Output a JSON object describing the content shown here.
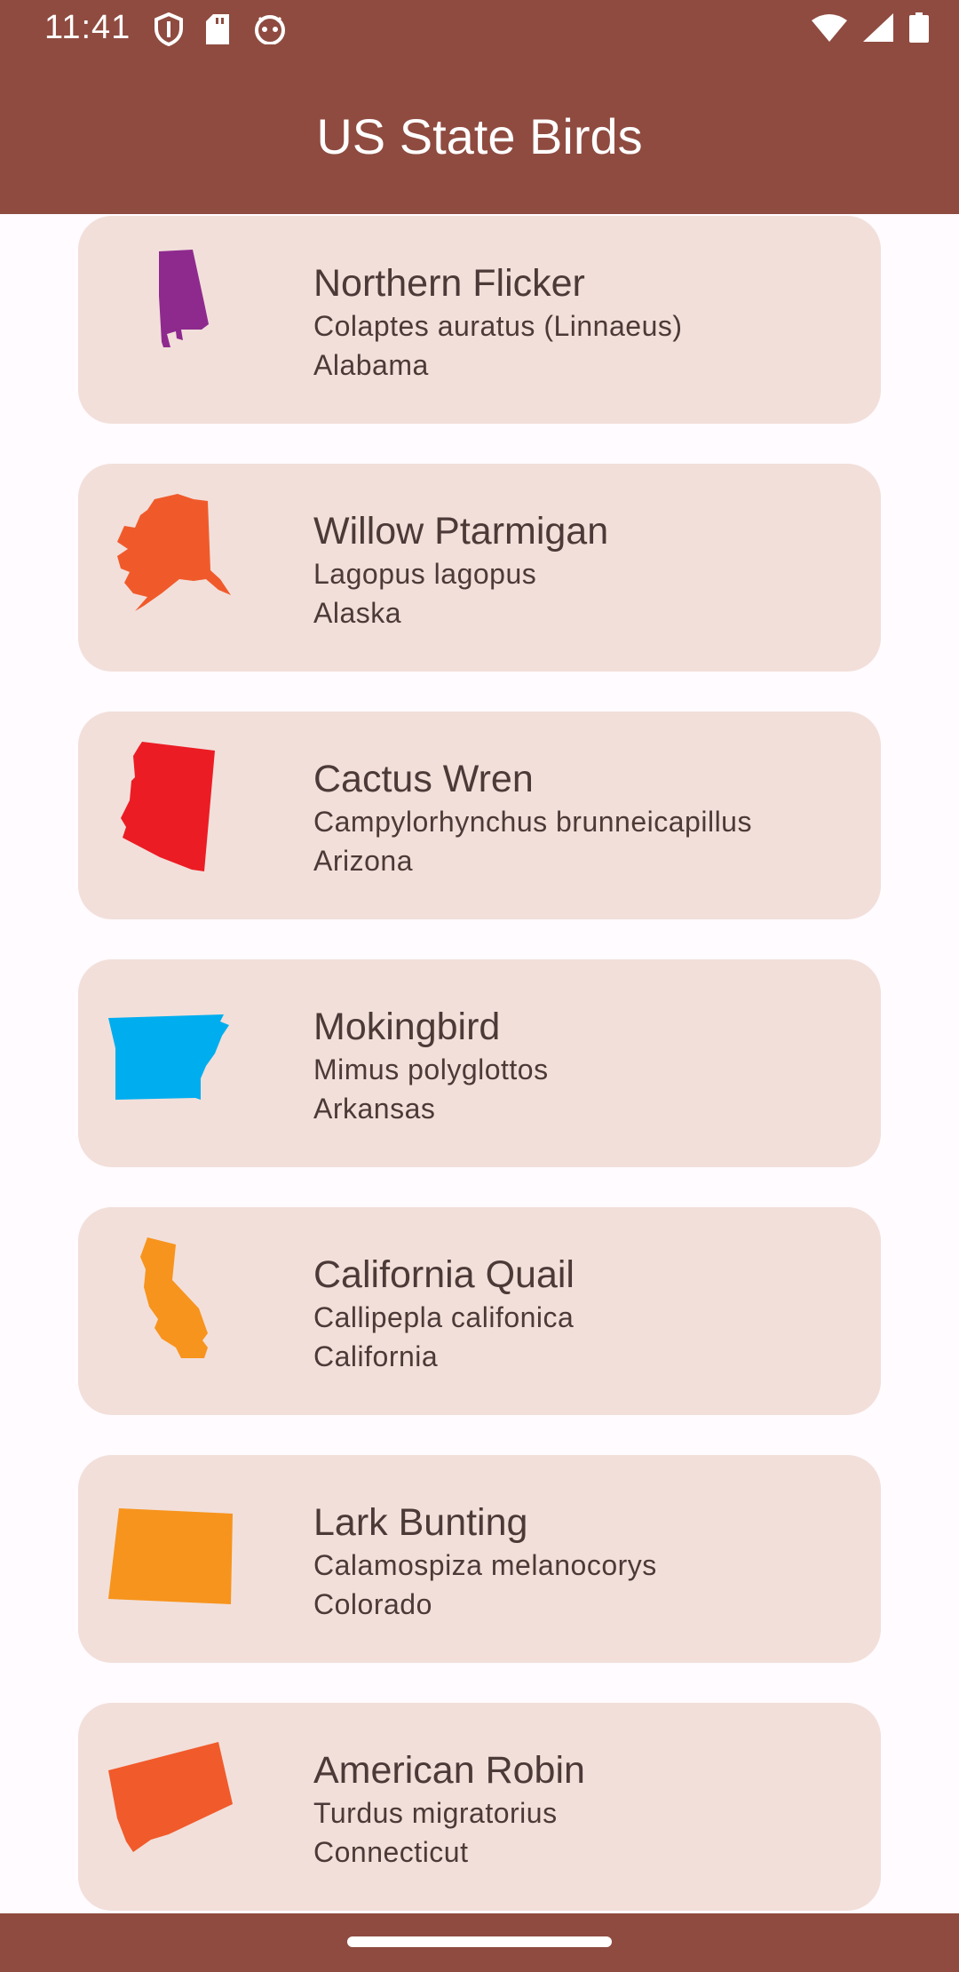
{
  "status_bar": {
    "time": "11:41",
    "left_icons": [
      "shield-icon",
      "sd-card-icon",
      "android-debug-icon"
    ],
    "right_icons": [
      "wifi-icon",
      "cell-signal-icon",
      "battery-icon"
    ]
  },
  "app_bar": {
    "title": "US State Birds"
  },
  "colors": {
    "app_bar": "#8f4b40",
    "card": "#f2dfda",
    "text": "#4b3a37",
    "background": "#fffbfe"
  },
  "birds": [
    {
      "name": "Northern Flicker",
      "scientific": "Colaptes auratus (Linnaeus)",
      "state": "Alabama",
      "map_icon": "alabama-map-icon",
      "map_color": "#8e2a8e"
    },
    {
      "name": "Willow Ptarmigan",
      "scientific": "Lagopus lagopus",
      "state": "Alaska",
      "map_icon": "alaska-map-icon",
      "map_color": "#f05a2b"
    },
    {
      "name": "Cactus Wren",
      "scientific": "Campylorhynchus brunneicapillus",
      "state": "Arizona",
      "map_icon": "arizona-map-icon",
      "map_color": "#ec1c24"
    },
    {
      "name": "Mokingbird",
      "scientific": "Mimus polyglottos",
      "state": "Arkansas",
      "map_icon": "arkansas-map-icon",
      "map_color": "#00aeef"
    },
    {
      "name": "California Quail",
      "scientific": "Callipepla califonica",
      "state": "California",
      "map_icon": "california-map-icon",
      "map_color": "#f7941d"
    },
    {
      "name": "Lark Bunting",
      "scientific": "Calamospiza melanocorys",
      "state": "Colorado",
      "map_icon": "colorado-map-icon",
      "map_color": "#f7941d"
    },
    {
      "name": "American Robin",
      "scientific": "Turdus migratorius",
      "state": "Connecticut",
      "map_icon": "connecticut-map-icon",
      "map_color": "#f15a2b"
    }
  ]
}
